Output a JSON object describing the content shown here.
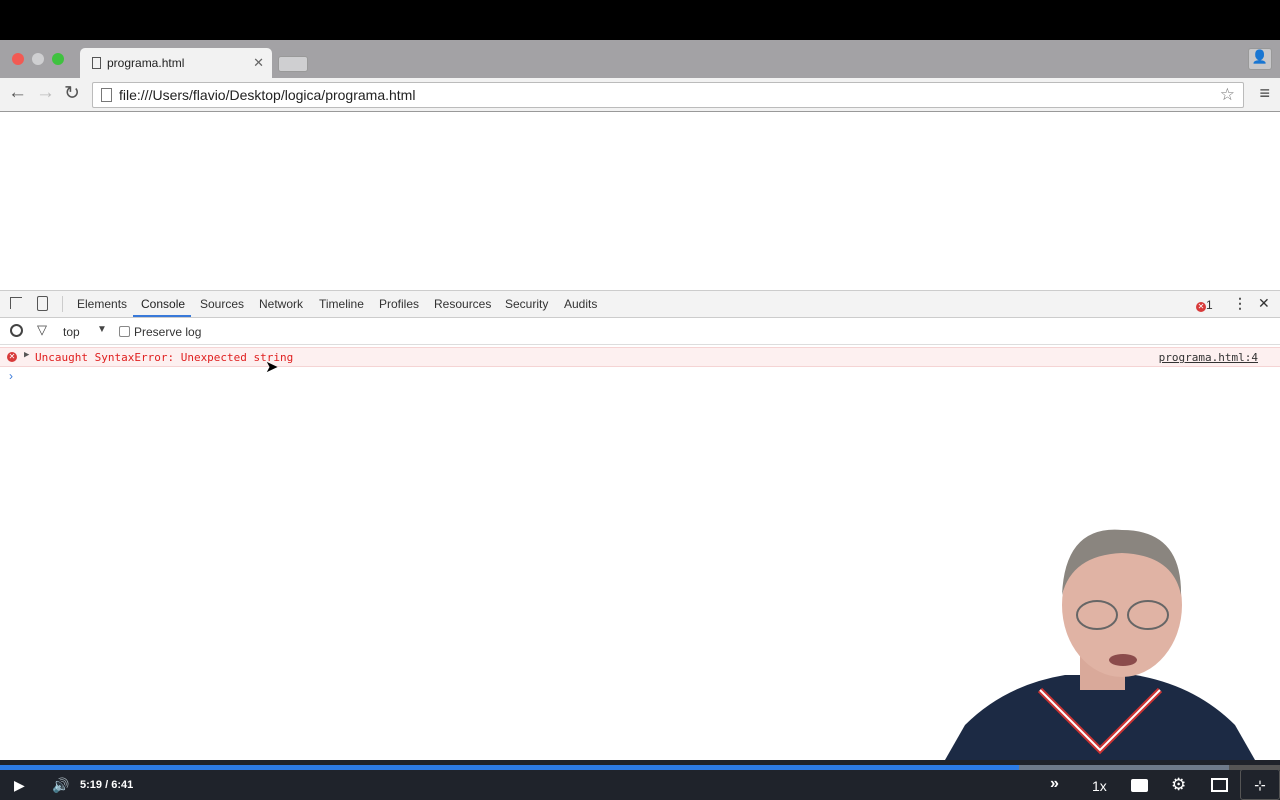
{
  "browser": {
    "tab_title": "programa.html",
    "url": "file:///Users/flavio/Desktop/logica/programa.html"
  },
  "devtools": {
    "tabs": [
      "Elements",
      "Console",
      "Sources",
      "Network",
      "Timeline",
      "Profiles",
      "Resources",
      "Security",
      "Audits"
    ],
    "active_tab": "Console",
    "error_count": "1",
    "context": "top",
    "preserve_log_label": "Preserve log",
    "preserve_log_checked": false,
    "console": {
      "error_message": "Uncaught SyntaxError: Unexpected string",
      "error_source": "programa.html:4"
    }
  },
  "player": {
    "current_time": "5:19",
    "separator": "/",
    "duration": "6:41",
    "played_percent": 79.6,
    "buffered_percent": 96,
    "speed": "1x",
    "accent": "#2c7be5"
  }
}
